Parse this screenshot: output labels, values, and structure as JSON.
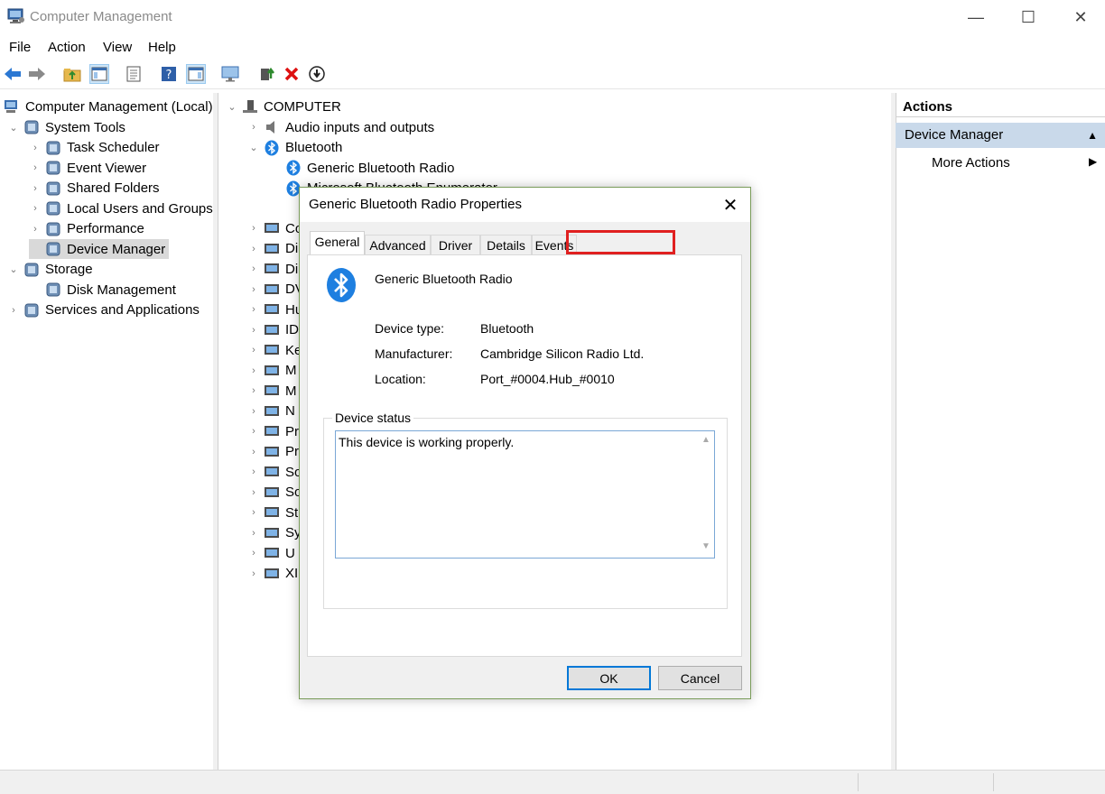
{
  "window": {
    "title": "Computer Management",
    "minimize": "—",
    "maximize": "☐",
    "close": "✕"
  },
  "menu": [
    "File",
    "Action",
    "View",
    "Help"
  ],
  "left_tree": {
    "root": "Computer Management (Local)",
    "items": [
      {
        "label": "System Tools",
        "icon": "tools-icon",
        "chev": "⌄"
      },
      {
        "label": "Task Scheduler",
        "icon": "clock-icon",
        "chev": "›"
      },
      {
        "label": "Event Viewer",
        "icon": "event-viewer-icon",
        "chev": "›"
      },
      {
        "label": "Shared Folders",
        "icon": "shared-folder-icon",
        "chev": "›"
      },
      {
        "label": "Local Users and Groups",
        "icon": "users-icon",
        "chev": "›"
      },
      {
        "label": "Performance",
        "icon": "performance-icon",
        "chev": "›"
      },
      {
        "label": "Device Manager",
        "icon": "device-manager-icon",
        "chev": ""
      },
      {
        "label": "Storage",
        "icon": "storage-icon",
        "chev": "⌄"
      },
      {
        "label": "Disk Management",
        "icon": "disk-icon",
        "chev": ""
      },
      {
        "label": "Services and Applications",
        "icon": "services-icon",
        "chev": "›"
      }
    ]
  },
  "device_tree": {
    "root": "COMPUTER",
    "top_items": [
      {
        "label": "Audio inputs and outputs",
        "chev": "›"
      },
      {
        "label": "Bluetooth",
        "chev": "⌄"
      },
      {
        "label": "Generic Bluetooth Radio",
        "chev": ""
      },
      {
        "label": "Microsoft Bluetooth Enumerator",
        "chev": ""
      }
    ],
    "truncated": [
      "Co",
      "Di",
      "Di",
      "DV",
      "Hu",
      "ID",
      "Ke",
      "M",
      "M",
      "N",
      "Pr",
      "Pr",
      "So",
      "So",
      "St",
      "Sy",
      "U",
      "XI"
    ]
  },
  "actions": {
    "header": "Actions",
    "section": "Device Manager",
    "more": "More Actions"
  },
  "dialog": {
    "title": "Generic Bluetooth Radio Properties",
    "tabs": [
      "General",
      "Advanced",
      "Driver",
      "Details",
      "Events"
    ],
    "device_name": "Generic Bluetooth Radio",
    "fields": [
      {
        "label": "Device type:",
        "value": "Bluetooth"
      },
      {
        "label": "Manufacturer:",
        "value": "Cambridge Silicon Radio Ltd."
      },
      {
        "label": "Location:",
        "value": "Port_#0004.Hub_#0010"
      }
    ],
    "status_label": "Device status",
    "status_text": "This device is working properly.",
    "ok": "OK",
    "cancel": "Cancel"
  }
}
